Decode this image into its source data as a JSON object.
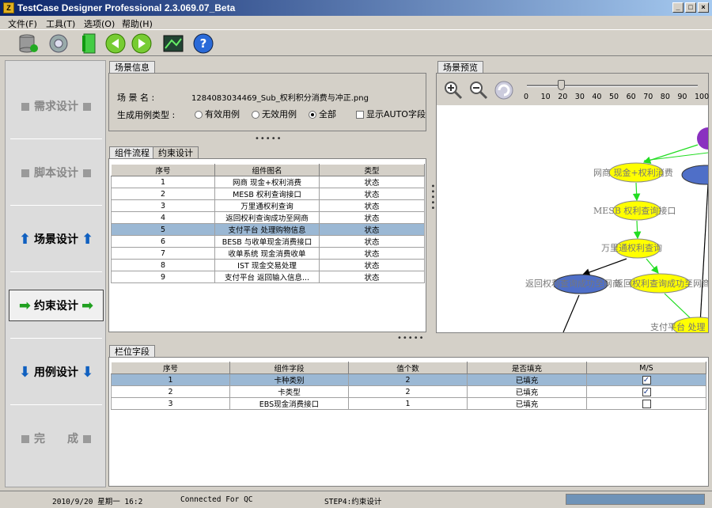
{
  "window": {
    "title": "TestCase Designer Professional  2.3.069.07_Beta"
  },
  "menu": [
    "文件(F)",
    "工具(T)",
    "选项(O)",
    "帮助(H)"
  ],
  "toolbar": [
    "database-icon",
    "gear-icon",
    "document-icon",
    "back-icon",
    "forward-icon",
    "image-icon",
    "help-icon"
  ],
  "nav": [
    {
      "label": "需求设计",
      "state": "disabled"
    },
    {
      "label": "脚本设计",
      "state": "disabled"
    },
    {
      "label": "场景设计",
      "state": "enabled"
    },
    {
      "label": "约束设计",
      "state": "active"
    },
    {
      "label": "用例设计",
      "state": "enabled"
    },
    {
      "label": "完　　成",
      "state": "disabled"
    }
  ],
  "scene_info": {
    "tab": "场景信息",
    "name_label": "场  景  名 :",
    "name_value": "1284083034469_Sub_权利积分消费与冲正.png",
    "type_label": "生成用例类型 :",
    "options": [
      "有效用例",
      "无效用例",
      "全部"
    ],
    "selected_option": "全部",
    "show_auto_label": "显示AUTO字段"
  },
  "flow": {
    "tabs": [
      "组件流程",
      "约束设计"
    ],
    "headers": [
      "序号",
      "组件图名",
      "类型"
    ],
    "rows": [
      [
        "1",
        "网商 现金+权利消费",
        "状态"
      ],
      [
        "2",
        "MESB 权利查询接口",
        "状态"
      ],
      [
        "3",
        "万里通权利查询",
        "状态"
      ],
      [
        "4",
        "返回权利查询成功至网商",
        "状态"
      ],
      [
        "5",
        "支付平台 处理购物信息",
        "状态"
      ],
      [
        "6",
        "BESB 与收单现金消费接口",
        "状态"
      ],
      [
        "7",
        "收单系统 现金消费收单",
        "状态"
      ],
      [
        "8",
        "IST 现金交易处理",
        "状态"
      ],
      [
        "9",
        "支付平台 返回输入信息...",
        "状态"
      ]
    ],
    "selected_row": 4
  },
  "preview": {
    "tab": "场景预览",
    "zoom_ticks": [
      "0",
      "10",
      "20",
      "30",
      "40",
      "50",
      "60",
      "70",
      "80",
      "90",
      "100"
    ],
    "zoom_value": 20,
    "nodes": [
      "网商 现金+权利消费",
      "MESB 权利查询接口",
      "万里通权利查询",
      "返回权利查询成功至网商",
      "返回权利查询成功至网商",
      "支付平台 处理"
    ]
  },
  "fields": {
    "tab": "栏位字段",
    "headers": [
      "序号",
      "组件字段",
      "值个数",
      "是否填充",
      "M/S"
    ],
    "rows": [
      {
        "no": "1",
        "field": "卡种类别",
        "count": "2",
        "filled": "已填充",
        "ms": true
      },
      {
        "no": "2",
        "field": "卡类型",
        "count": "2",
        "filled": "已填充",
        "ms": true
      },
      {
        "no": "3",
        "field": "EBS现金消费接口",
        "count": "1",
        "filled": "已填充",
        "ms": false
      }
    ],
    "selected_row": 0
  },
  "status": {
    "datetime": "2010/9/20 星期一  16:2",
    "connection": "Connected For QC",
    "step": "STEP4:约束设计"
  },
  "colors": {
    "title_start": "#0a246a",
    "title_end": "#a6caf0",
    "selection": "#9bb8d4",
    "node_yellow": "#ffff00",
    "node_blue": "#4f6fc8",
    "edge_green": "#22dd22"
  }
}
